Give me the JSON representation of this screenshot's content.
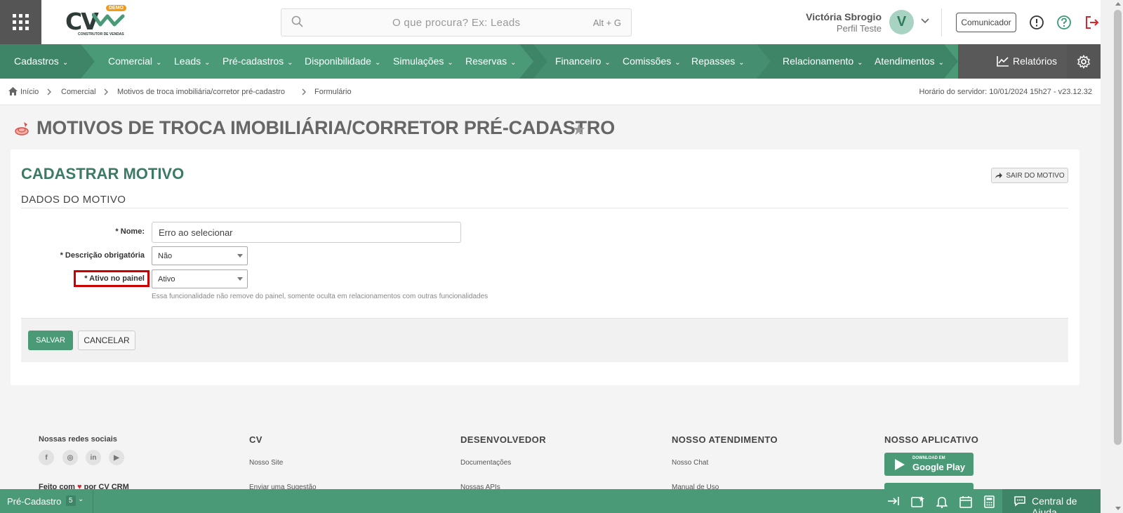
{
  "header": {
    "logo_text": "CV",
    "logo_badge": "DEMO",
    "logo_subtitle": "CONSTRUTOR DE VENDAS",
    "search_placeholder": "O que procura? Ex: Leads",
    "search_shortcut": "Alt + G",
    "user_name": "Victória Sbrogio",
    "user_profile": "Perfil Teste",
    "avatar_letter": "V",
    "comunicador_label": "Comunicador"
  },
  "nav": {
    "items": [
      {
        "label": "Cadastros"
      },
      {
        "label": "Comercial"
      },
      {
        "label": "Leads"
      },
      {
        "label": "Pré-cadastros"
      },
      {
        "label": "Disponibilidade"
      },
      {
        "label": "Simulações"
      },
      {
        "label": "Reservas"
      },
      {
        "label": "Financeiro"
      },
      {
        "label": "Comissões"
      },
      {
        "label": "Repasses"
      },
      {
        "label": "Relacionamento"
      },
      {
        "label": "Atendimentos"
      }
    ],
    "reports_label": "Relatórios",
    "chevron": "⌄"
  },
  "breadcrumb": {
    "items": [
      "Início",
      "Comercial",
      "Motivos de troca imobiliária/corretor pré-cadastro",
      "Formulário"
    ],
    "server_time": "Horário do servidor: 10/01/2024 15h27 - v23.12.32"
  },
  "page": {
    "title": "MOTIVOS DE TROCA IMOBILIÁRIA/CORRETOR PRÉ-CADASTRO"
  },
  "form": {
    "heading": "CADASTRAR MOTIVO",
    "exit_label": "SAIR DO MOTIVO",
    "section_title": "DADOS DO MOTIVO",
    "required_mark": "*",
    "fields": {
      "nome_label": "Nome:",
      "nome_value": "Erro ao selecionar",
      "descricao_label": "Descrição obrigatória",
      "descricao_value": "Não",
      "ativo_label": "Ativo no painel",
      "ativo_value": "Ativo",
      "ativo_hint": "Essa funcionalidade não remove do painel, somente oculta em relacionamentos com outras funcionalidades"
    },
    "save_label": "SALVAR",
    "cancel_label": "CANCELAR"
  },
  "footer": {
    "social_title": "Nossas redes sociais",
    "made_with": "Feito com",
    "made_by": "por CV CRM",
    "columns": [
      {
        "title": "CV",
        "links": [
          "Nosso Site",
          "Enviar uma Sugestão"
        ]
      },
      {
        "title": "DESENVOLVEDOR",
        "links": [
          "Documentações",
          "Nossas APIs"
        ]
      },
      {
        "title": "NOSSO ATENDIMENTO",
        "links": [
          "Nosso Chat",
          "Manual de Uso"
        ]
      },
      {
        "title": "NOSSO APLICATIVO",
        "links": []
      }
    ],
    "gplay_small": "DOWNLOAD EM",
    "gplay_big": "Google Play"
  },
  "bottombar": {
    "module": "Pré-Cadastro",
    "count": "5",
    "help_label": "Central de Ajuda"
  },
  "colors": {
    "brand_green": "#4a9a78",
    "nav_dark_segment": "#3e8466",
    "heading_green": "#3b7a64",
    "highlight_red": "#cc0000",
    "logout_red": "#d9262c"
  }
}
